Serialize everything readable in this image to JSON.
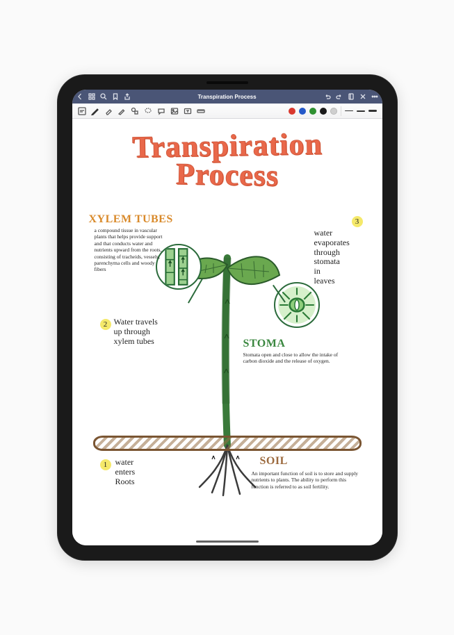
{
  "titlebar": {
    "title": "Transpiration Process"
  },
  "toolbar": {
    "swatches": {
      "red": "#d9382e",
      "blue": "#2559c9",
      "green": "#2f9031",
      "black": "#1a1a1a",
      "grey": "#9b9b9b"
    }
  },
  "note": {
    "title_line1": "Transpiration",
    "title_line2": "Process",
    "sections": {
      "xylem": {
        "heading": "XYLEM TUBES",
        "desc": "a compound tissue in vascular plants that helps provide support and that conducts water and nutrients upward from the roots, consisting of tracheids, vessels, parenchyma cells and woody fibers"
      },
      "stoma": {
        "heading": "STOMA",
        "desc": "Stomata open and close to allow the intake of carbon dioxide and the release of oxygen."
      },
      "soil": {
        "heading": "SOIL",
        "desc": "An important function of soil is to store and supply nutrients to plants. The ability to perform this function is referred to as soil fertility."
      }
    },
    "steps": {
      "s1": {
        "num": "1",
        "text_l1": "water",
        "text_l2": "enters",
        "text_l3": "Roots"
      },
      "s2": {
        "num": "2",
        "text_l1": "Water travels",
        "text_l2": "up through",
        "text_l3": "xylem tubes"
      },
      "s3": {
        "num": "3",
        "text_l1": "water",
        "text_l2": "evaporates",
        "text_l3": "through",
        "text_l4": "stomata",
        "text_l5": "in",
        "text_l6": "leaves"
      }
    }
  }
}
